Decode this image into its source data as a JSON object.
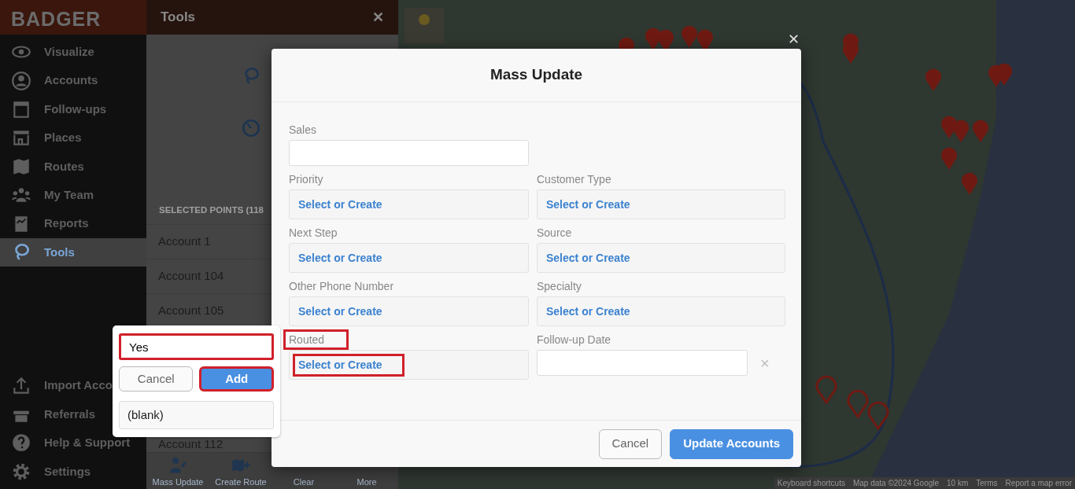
{
  "brand": "BADGER",
  "nav": [
    {
      "label": "Visualize",
      "selected": false
    },
    {
      "label": "Accounts",
      "selected": false
    },
    {
      "label": "Follow-ups",
      "selected": false
    },
    {
      "label": "Places",
      "selected": false
    },
    {
      "label": "Routes",
      "selected": false
    },
    {
      "label": "My Team",
      "selected": false
    },
    {
      "label": "Reports",
      "selected": false
    },
    {
      "label": "Tools",
      "selected": true
    }
  ],
  "nav_bottom": [
    "Import Acco",
    "Referrals",
    "Help & Support",
    "Settings"
  ],
  "tools_panel": {
    "title": "Tools",
    "close": "✕",
    "section_title": "SELECTED POINTS (118",
    "accounts": [
      "Account 1",
      "Account 104",
      "Account 105",
      "Account 112"
    ],
    "toolbar": [
      "Mass Update",
      "Create Route",
      "Clear",
      "More"
    ]
  },
  "map": {
    "attribution": [
      "Keyboard shortcuts",
      "Map data ©2024 Google",
      "10 km",
      "Terms",
      "Report a map error"
    ]
  },
  "modal": {
    "title": "Mass Update",
    "close": "✕",
    "fields": [
      {
        "label": "Sales",
        "kind": "text",
        "highlighted": false
      },
      {
        "label": "Priority",
        "kind": "select",
        "value": "Select or Create",
        "highlighted": false
      },
      {
        "label": "Customer Type",
        "kind": "select",
        "value": "Select or Create",
        "highlighted": false
      },
      {
        "label": "Next Step",
        "kind": "select",
        "value": "Select or Create",
        "highlighted": false
      },
      {
        "label": "Source",
        "kind": "select",
        "value": "Select or Create",
        "highlighted": false
      },
      {
        "label": "Other Phone Number",
        "kind": "select",
        "value": "Select or Create",
        "highlighted": false
      },
      {
        "label": "Specialty",
        "kind": "select",
        "value": "Select or Create",
        "highlighted": false
      },
      {
        "label": "Routed",
        "kind": "select",
        "value": "Select or Create",
        "highlighted": true
      },
      {
        "label": "Follow-up Date",
        "kind": "date",
        "clear": "×",
        "highlighted": false
      }
    ],
    "buttons": [
      {
        "label": "Cancel",
        "kind": "secondary"
      },
      {
        "label": "Update Accounts",
        "kind": "primary"
      }
    ]
  },
  "popover": {
    "value": "Yes",
    "value_highlighted": true,
    "buttons": [
      {
        "label": "Cancel",
        "kind": "secondary",
        "highlighted": false
      },
      {
        "label": "Add",
        "kind": "primary",
        "highlighted": true
      }
    ],
    "options": [
      "(blank)"
    ]
  }
}
